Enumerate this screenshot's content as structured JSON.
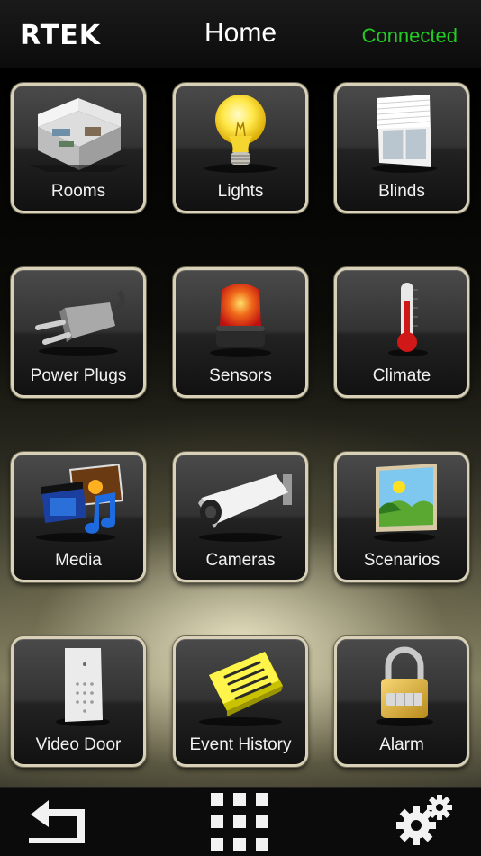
{
  "header": {
    "logo": "RTEK",
    "title": "Home",
    "status": "Connected",
    "status_color": "#22cc22"
  },
  "tiles": [
    {
      "label": "Rooms",
      "icon": "house-cutaway-icon"
    },
    {
      "label": "Lights",
      "icon": "light-bulb-icon"
    },
    {
      "label": "Blinds",
      "icon": "window-blind-icon"
    },
    {
      "label": "Power Plugs",
      "icon": "power-plug-icon"
    },
    {
      "label": "Sensors",
      "icon": "alarm-siren-icon"
    },
    {
      "label": "Climate",
      "icon": "thermometer-icon"
    },
    {
      "label": "Media",
      "icon": "media-film-music-icon"
    },
    {
      "label": "Cameras",
      "icon": "security-camera-icon"
    },
    {
      "label": "Scenarios",
      "icon": "landscape-picture-icon"
    },
    {
      "label": "Video Door",
      "icon": "door-keypad-icon"
    },
    {
      "label": "Event History",
      "icon": "notebook-icon"
    },
    {
      "label": "Alarm",
      "icon": "padlock-icon"
    }
  ],
  "footer": {
    "back_icon": "back-arrow-icon",
    "grid_icon": "grid-menu-icon",
    "settings_icon": "gears-icon"
  }
}
